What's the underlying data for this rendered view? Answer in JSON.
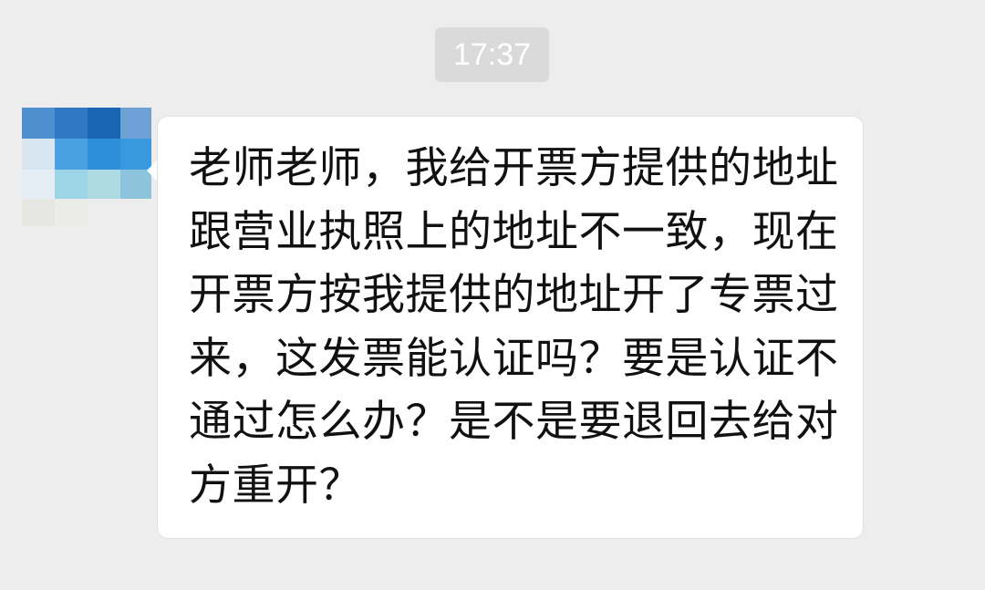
{
  "chat": {
    "timestamp": "17:37",
    "message": {
      "lines": [
        "老师老师，我给开票方提供的地址",
        "跟营业执照上的地址不一致，现在",
        "开票方按我提供的地址开了专票过",
        "来，这发票能认证吗？要是认证不",
        "通过怎么办？是不是要退回去给对",
        "方重开？"
      ]
    }
  },
  "colors": {
    "background": "#ededed",
    "timestamp_bg": "#dadada",
    "bubble": "#ffffff",
    "text": "#111111"
  }
}
